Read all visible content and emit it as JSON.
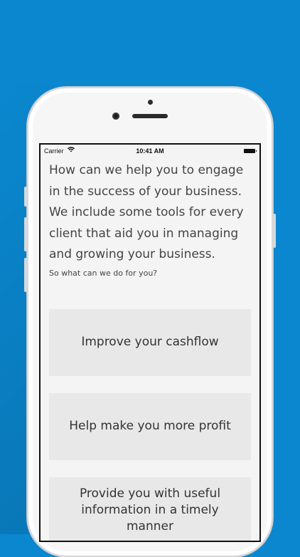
{
  "status_bar": {
    "carrier": "Carrier",
    "time": "10:41 AM"
  },
  "intro_text": "How can we help you to engage in the success of your business. We include some tools for every client that aid you in managing and growing your business.",
  "subtext": "So what can we do for you?",
  "options": [
    {
      "label": "Improve your cashflow"
    },
    {
      "label": "Help make you more profit"
    },
    {
      "label": "Provide you with useful information in a timely manner"
    }
  ],
  "colors": {
    "background": "#0a87cf",
    "option_bg": "#e8e8e8",
    "screen_bg": "#f4f4f4"
  }
}
